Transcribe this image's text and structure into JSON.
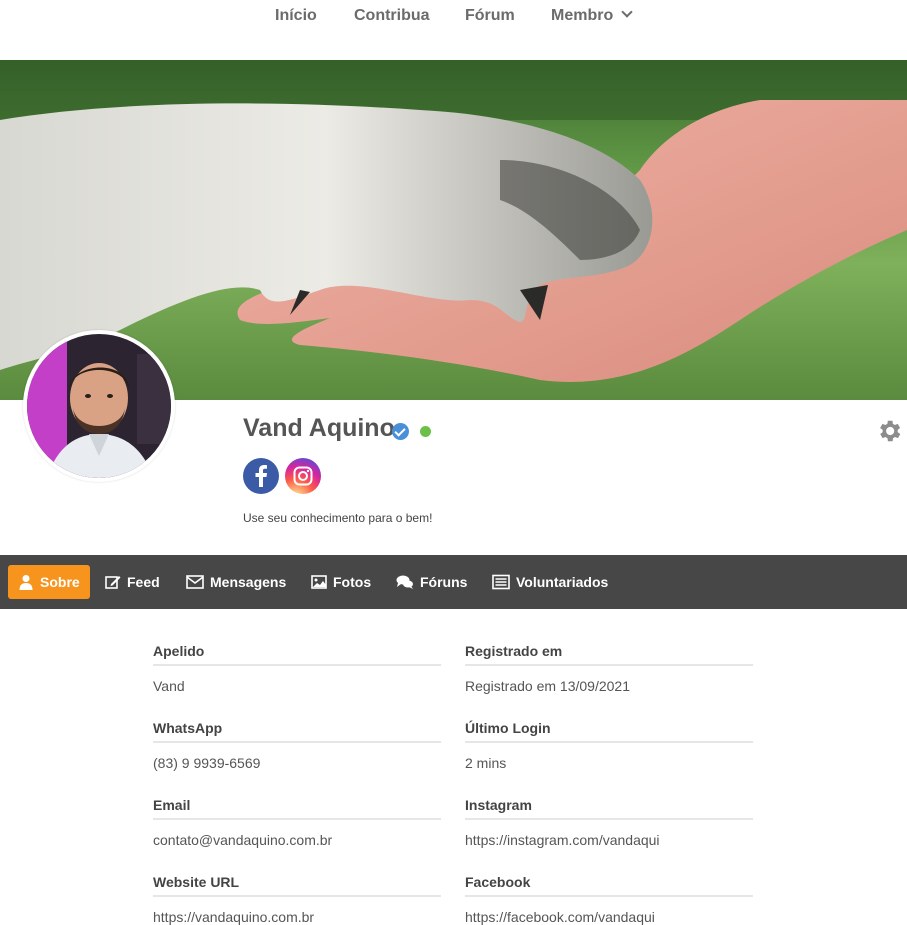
{
  "nav": {
    "items": [
      "Início",
      "Contribua",
      "Fórum",
      "Membro"
    ]
  },
  "profile": {
    "name": "Vand Aquino",
    "bio": "Use seu conhecimento para o bem!"
  },
  "tabs": [
    "Sobre",
    "Feed",
    "Mensagens",
    "Fotos",
    "Fóruns",
    "Voluntariados"
  ],
  "fields": {
    "nickname": {
      "label": "Apelido",
      "value": "Vand"
    },
    "registered": {
      "label": "Registrado em",
      "value": "Registrado em 13/09/2021"
    },
    "whatsapp": {
      "label": "WhatsApp",
      "value": "(83) 9 9939-6569"
    },
    "last_login": {
      "label": "Último Login",
      "value": "2 mins"
    },
    "email": {
      "label": "Email",
      "value": "contato@vandaquino.com.br"
    },
    "instagram": {
      "label": "Instagram",
      "value": "https://instagram.com/vandaqui"
    },
    "website": {
      "label": "Website URL",
      "value": "https://vandaquino.com.br"
    },
    "facebook": {
      "label": "Facebook",
      "value": "https://facebook.com/vandaqui"
    }
  },
  "colors": {
    "accent": "#f7941d",
    "tabbar": "#474747",
    "online": "#6cc04a",
    "verified": "#4a90d9"
  }
}
